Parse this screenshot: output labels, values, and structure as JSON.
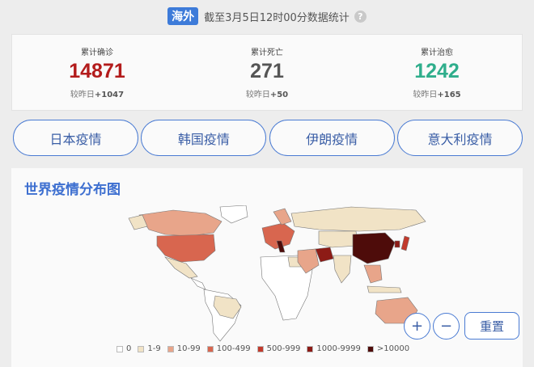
{
  "header": {
    "tag": "海外",
    "text": "截至3月5日12时00分数据统计",
    "help_symbol": "?"
  },
  "stats": [
    {
      "label": "累计确诊",
      "value": "14871",
      "delta_prefix": "较昨日",
      "delta": "+1047",
      "color": "#b31b1b"
    },
    {
      "label": "累计死亡",
      "value": "271",
      "delta_prefix": "较昨日",
      "delta": "+50",
      "color": "#555555"
    },
    {
      "label": "累计治愈",
      "value": "1242",
      "delta_prefix": "较昨日",
      "delta": "+165",
      "color": "#2fae8c"
    }
  ],
  "country_buttons": [
    "日本疫情",
    "韩国疫情",
    "伊朗疫情",
    "意大利疫情"
  ],
  "map": {
    "title": "世界疫情分布图",
    "zoom_in": "+",
    "zoom_out": "−",
    "reset": "重置",
    "legend": [
      {
        "label": "0",
        "color": "#ffffff"
      },
      {
        "label": "1-9",
        "color": "#f1e3c6"
      },
      {
        "label": "10-99",
        "color": "#e8a58a"
      },
      {
        "label": "100-499",
        "color": "#d8664f"
      },
      {
        "label": "500-999",
        "color": "#c23a2c"
      },
      {
        "label": "1000-9999",
        "color": "#8d1b16"
      },
      {
        "label": ">10000",
        "color": "#4e0c0a"
      }
    ]
  }
}
